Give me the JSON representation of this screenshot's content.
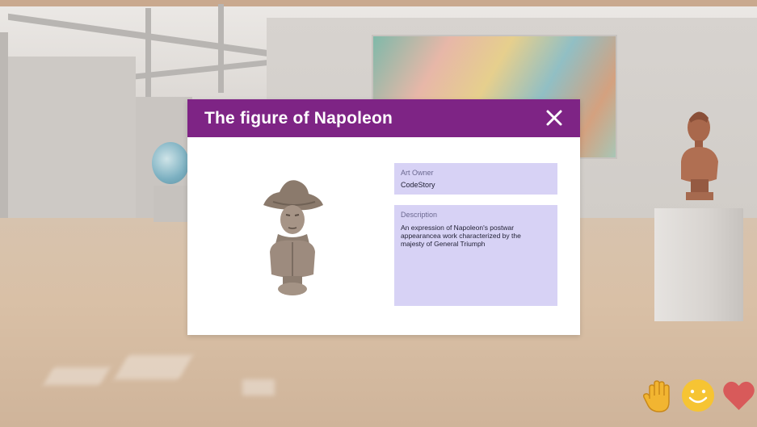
{
  "modal": {
    "title": "The figure of Napoleon",
    "close_icon": "close-icon",
    "art_owner_label": "Art Owner",
    "art_owner_value": "CodeStory",
    "description_label": "Description",
    "description_value": "An expression of Napoleon's postwar appearancea work characterized by the majesty of General Triumph"
  },
  "reactions": [
    {
      "icon": "raise-hand-icon",
      "color": "#f2b531"
    },
    {
      "icon": "smile-icon",
      "color": "#f6c433"
    },
    {
      "icon": "heart-icon",
      "color": "#d85a5a"
    }
  ],
  "colors": {
    "header": "#7e2485",
    "info_box": "#d7d2f5"
  }
}
